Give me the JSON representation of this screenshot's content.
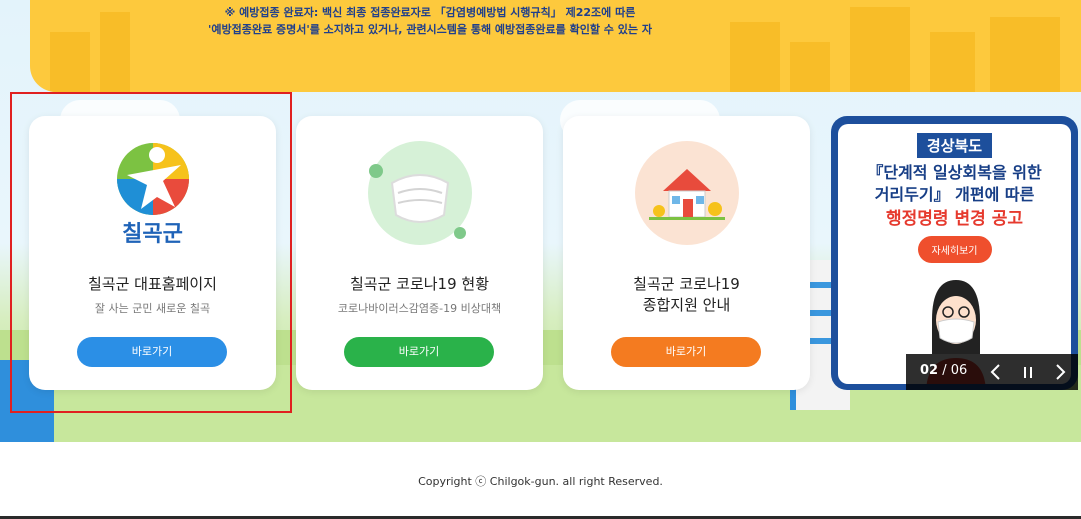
{
  "banner": {
    "line1": "※ 예방접종 완료자: 백신 최종 접종완료자로 「감염병예방법 시행규칙」 제22조에 따른",
    "line2": "'예방접종완료 증명서'를 소지하고 있거나, 관련시스템을 통해 예방접종완료를 확인할 수 있는 자"
  },
  "cards": [
    {
      "logo_text": "칠곡군",
      "title": "칠곡군 대표홈페이지",
      "subtitle": "잘 사는 군민 새로운 칠곡",
      "button_label": "바로가기",
      "button_color": "#2b8fe6"
    },
    {
      "title": "칠곡군 코로나19 현황",
      "subtitle": "코로나바이러스감염증-19 비상대책",
      "button_label": "바로가기",
      "button_color": "#2ab24a"
    },
    {
      "title_line1": "칠곡군 코로나19",
      "title_line2": "종합지원 안내",
      "button_label": "바로가기",
      "button_color": "#f47b20"
    }
  ],
  "notice": {
    "badge": "경상북도",
    "line1": "『단계적 일상회복을 위한",
    "line2": "거리두기』 개편에 따른",
    "line3": "행정명령 변경 공고",
    "detail_label": "자세히보기"
  },
  "pager": {
    "current": "02",
    "separator": " / ",
    "total": "06",
    "prev_icon": "chevron-left-icon",
    "pause_icon": "pause-icon",
    "next_icon": "chevron-right-icon"
  },
  "footer": {
    "copyright": "Copyright ⓒ Chilgok-gun. all right Reserved."
  }
}
